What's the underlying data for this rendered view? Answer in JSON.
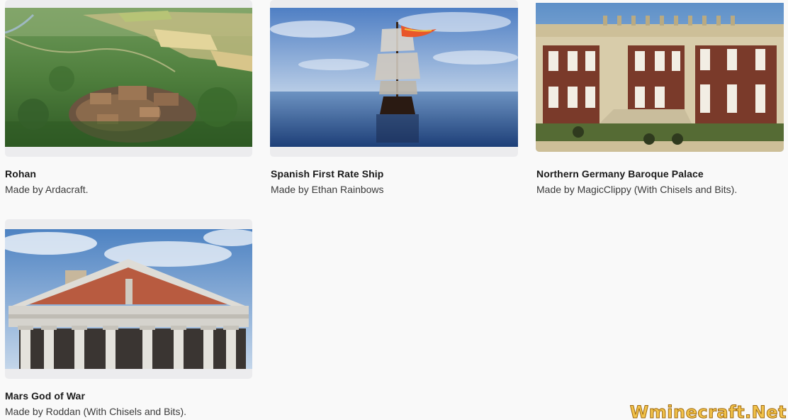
{
  "cards": [
    {
      "title": "Rohan",
      "byline": "Made by Ardacraft.",
      "image": "rohan-aerial-landscape"
    },
    {
      "title": "Spanish First Rate Ship",
      "byline": "Made by Ethan Rainbows",
      "image": "galleon-at-sea"
    },
    {
      "title": "Northern Germany Baroque Palace",
      "byline": "Made by MagicClippy (With Chisels and Bits).",
      "image": "baroque-palace-facade"
    },
    {
      "title": "Mars God of War",
      "byline": "Made by Roddan (With Chisels and Bits).",
      "image": "roman-temple-pediment"
    }
  ],
  "watermark": "Wminecraft.Net",
  "colors": {
    "page_bg": "#f9f9f9",
    "card_bg": "#ececee",
    "title": "#1a1a1a",
    "byline": "#3a3a3a",
    "watermark_fill": "#f1c24a"
  }
}
